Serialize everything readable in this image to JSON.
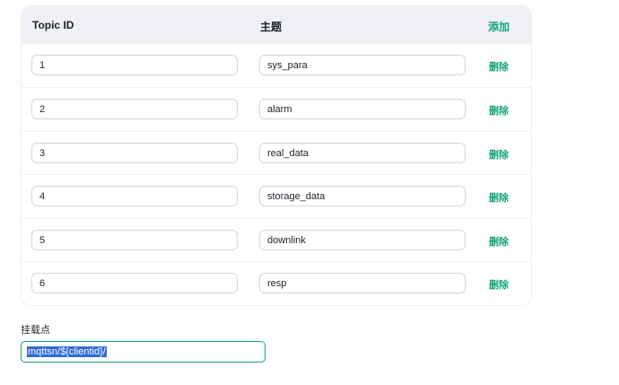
{
  "table": {
    "headers": {
      "topic_id": "Topic ID",
      "topic": "主题",
      "add": "添加"
    },
    "rows": [
      {
        "id": "1",
        "topic": "sys_para",
        "action": "删除"
      },
      {
        "id": "2",
        "topic": "alarm",
        "action": "删除"
      },
      {
        "id": "3",
        "topic": "real_data",
        "action": "删除"
      },
      {
        "id": "4",
        "topic": "storage_data",
        "action": "删除"
      },
      {
        "id": "5",
        "topic": "downlink",
        "action": "删除"
      },
      {
        "id": "6",
        "topic": "resp",
        "action": "删除"
      }
    ]
  },
  "mountpoint": {
    "label": "挂载点",
    "value": "mqttsn/${clientid}/"
  },
  "colors": {
    "accent": "#16a37a",
    "selection": "#2f6bd8",
    "header_bg": "#eef0f4"
  }
}
